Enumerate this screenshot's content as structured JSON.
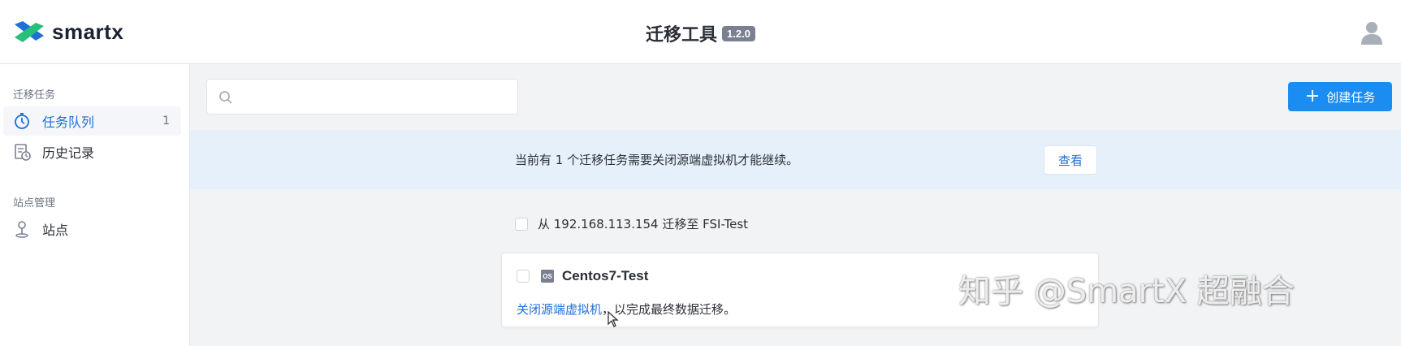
{
  "header": {
    "brand": "smartx",
    "title": "迁移工具",
    "version": "1.2.0"
  },
  "sidebar": {
    "group1_label": "迁移任务",
    "items": [
      {
        "label": "任务队列",
        "count": "1",
        "icon": "stopwatch-icon",
        "active": true
      },
      {
        "label": "历史记录",
        "icon": "history-icon"
      }
    ],
    "group2_label": "站点管理",
    "site_item": {
      "label": "站点",
      "icon": "pin-icon"
    }
  },
  "toolbar": {
    "search_placeholder": "",
    "create_label": "创建任务"
  },
  "banner": {
    "text": "当前有 1 个迁移任务需要关闭源端虚拟机才能继续。",
    "view_label": "查看"
  },
  "task_group": {
    "label": "从 192.168.113.154 迁移至 FSI-Test"
  },
  "task_card": {
    "os_badge": "OS",
    "vm_name": "Centos7-Test",
    "action_link": "关闭源端虚拟机",
    "message_rest": "，以完成最终数据迁移。"
  },
  "watermark": "知乎 @SmartX 超融合",
  "colors": {
    "accent": "#1b8cf2",
    "link": "#1f6fd6",
    "banner_bg": "#e6f0fb",
    "page_bg": "#f2f3f5"
  }
}
